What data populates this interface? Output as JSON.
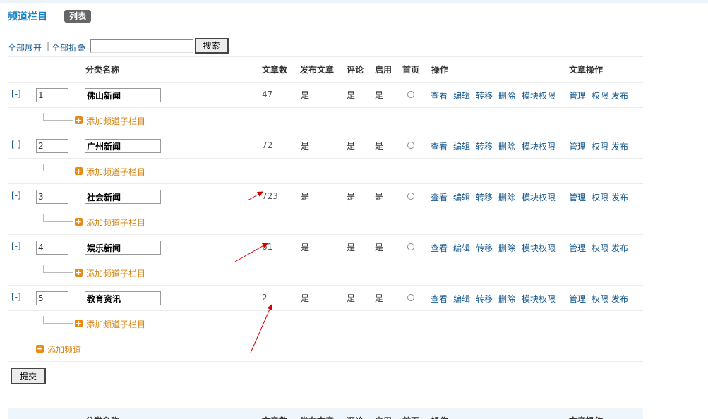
{
  "page": {
    "title": "频道栏目",
    "view_badge": "列表"
  },
  "toolbar": {
    "expand_all": "全部展开",
    "collapse_all": "全部折叠",
    "search_value": "",
    "search_button": "搜索"
  },
  "columns": {
    "name": "分类名称",
    "article_count": "文章数",
    "publish": "发布文章",
    "comment": "评论",
    "enabled": "启用",
    "homepage": "首页",
    "actions": "操作",
    "article_actions": "文章操作"
  },
  "rows": [
    {
      "toggle": "[-]",
      "sort": "1",
      "name": "佛山新闻",
      "count": "47",
      "publish": "是",
      "comment": "是",
      "enabled": "是"
    },
    {
      "toggle": "[-]",
      "sort": "2",
      "name": "广州新闻",
      "count": "72",
      "publish": "是",
      "comment": "是",
      "enabled": "是"
    },
    {
      "toggle": "[-]",
      "sort": "3",
      "name": "社会新闻",
      "count": "723",
      "publish": "是",
      "comment": "是",
      "enabled": "是"
    },
    {
      "toggle": "[-]",
      "sort": "4",
      "name": "娱乐新闻",
      "count": "61",
      "publish": "是",
      "comment": "是",
      "enabled": "是"
    },
    {
      "toggle": "[-]",
      "sort": "5",
      "name": "教育资讯",
      "count": "2",
      "publish": "是",
      "comment": "是",
      "enabled": "是"
    }
  ],
  "row_actions": {
    "view": "查看",
    "edit": "编辑",
    "move": "转移",
    "delete": "删除",
    "module_perm": "模块权限"
  },
  "article_actions": {
    "manage": "管理",
    "perm": "权限",
    "publish": "发布"
  },
  "add_subcategory": "添加频道子栏目",
  "add_channel": "添加频道",
  "submit_button": "提交",
  "colors": {
    "link": "#15588f",
    "title": "#1a84c6",
    "add": "#d7800b",
    "annotation_arrow": "#d40000"
  }
}
